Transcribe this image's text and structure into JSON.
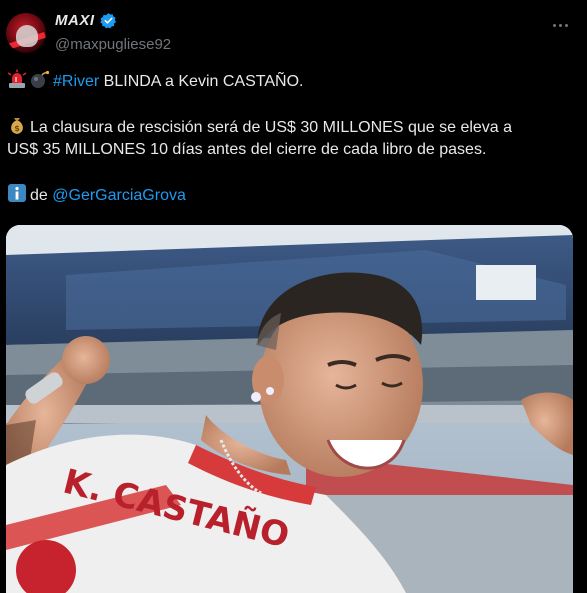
{
  "author": {
    "display_name": "MAXI",
    "handle": "@maxpugliese92"
  },
  "tweet": {
    "line1": {
      "hashtag": "#River",
      "rest": " BLINDA a Kevin CASTAÑO."
    },
    "line2": "La clausura de rescisión será de US$ 30 MILLONES que se eleva a",
    "line3": "US$ 35 MILLONES 10 días antes del cierre de cada libro de pases.",
    "line4": {
      "prefix": "de ",
      "mention": "@GerGarciaGrova"
    }
  },
  "media": {
    "jersey_text": "K. CASTAÑO"
  },
  "icons": [
    "siren-icon",
    "bomb-icon",
    "money-bag-icon",
    "info-icon",
    "verified-badge-icon",
    "more-options-icon"
  ],
  "colors": {
    "background": "#000000",
    "text": "#e7e9ea",
    "secondary": "#71767b",
    "link": "#1d9bf0",
    "verified": "#1d9bf0"
  }
}
